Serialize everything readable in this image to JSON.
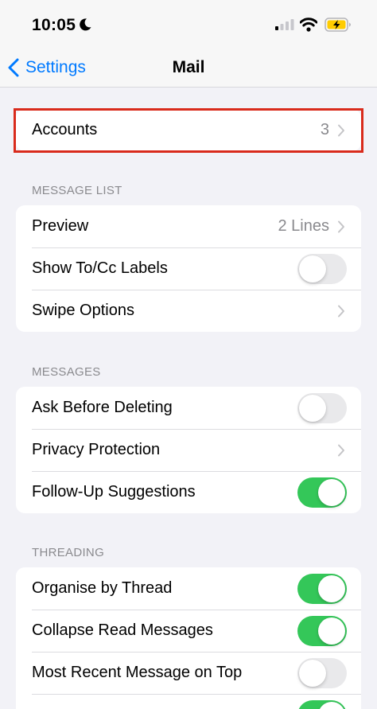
{
  "status_bar": {
    "time": "10:05",
    "icons": [
      "moon-icon",
      "cellular-signal-icon",
      "wifi-icon",
      "battery-charging-icon"
    ]
  },
  "nav": {
    "back_label": "Settings",
    "title": "Mail"
  },
  "accounts": {
    "label": "Accounts",
    "value": "3"
  },
  "message_list": {
    "header": "MESSAGE LIST",
    "rows": [
      {
        "label": "Preview",
        "value": "2 Lines",
        "type": "disclosure"
      },
      {
        "label": "Show To/Cc Labels",
        "type": "toggle",
        "on": false
      },
      {
        "label": "Swipe Options",
        "type": "disclosure"
      }
    ]
  },
  "messages": {
    "header": "MESSAGES",
    "rows": [
      {
        "label": "Ask Before Deleting",
        "type": "toggle",
        "on": false
      },
      {
        "label": "Privacy Protection",
        "type": "disclosure"
      },
      {
        "label": "Follow-Up Suggestions",
        "type": "toggle",
        "on": true
      }
    ]
  },
  "threading": {
    "header": "THREADING",
    "rows": [
      {
        "label": "Organise by Thread",
        "type": "toggle",
        "on": true
      },
      {
        "label": "Collapse Read Messages",
        "type": "toggle",
        "on": true
      },
      {
        "label": "Most Recent Message on Top",
        "type": "toggle",
        "on": false
      },
      {
        "label": "",
        "type": "toggle",
        "on": true
      }
    ]
  },
  "colors": {
    "accent": "#007aff",
    "toggle_on": "#34c759",
    "toggle_off": "#e9e9eb",
    "highlight": "#d92b1c",
    "background": "#f2f2f7"
  }
}
